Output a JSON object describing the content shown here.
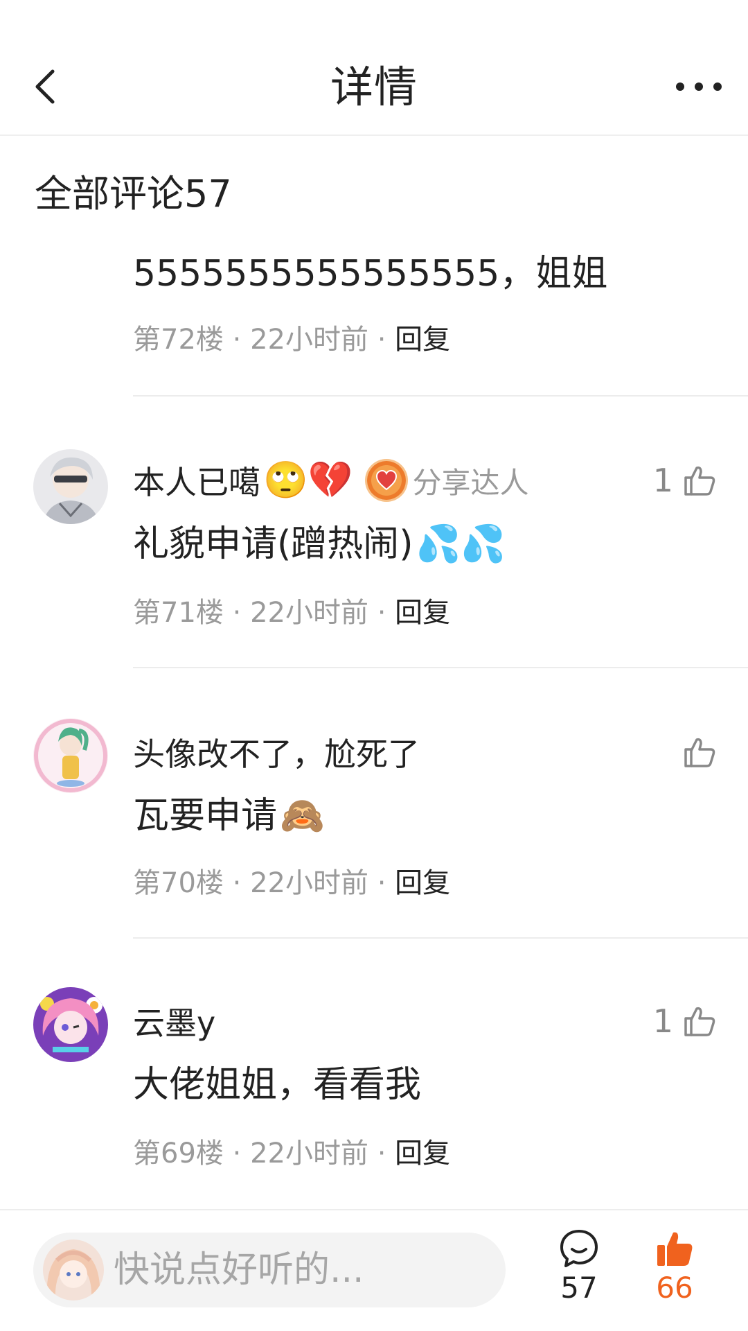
{
  "nav": {
    "title": "详情",
    "back_icon": "chevron-left-icon",
    "more_icon": "more-dots-icon"
  },
  "section": {
    "title": "全部评论57"
  },
  "comments": [
    {
      "username": "",
      "text": "5555555555555555，姐姐",
      "floor": "第72楼",
      "time": "22小时前",
      "reply": "回复",
      "likes": ""
    },
    {
      "username": "本人已噶",
      "username_emoji": "🙄💔",
      "badge_label": "分享达人",
      "text": "礼貌申请(蹭热闹)",
      "text_emoji": "💦💦",
      "floor": "第71楼",
      "time": "22小时前",
      "reply": "回复",
      "likes": "1"
    },
    {
      "username": "头像改不了，尬死了",
      "text": "瓦要申请",
      "text_emoji": "🙈",
      "floor": "第70楼",
      "time": "22小时前",
      "reply": "回复",
      "likes": ""
    },
    {
      "username": "云墨y",
      "text": "大佬姐姐，看看我",
      "floor": "第69楼",
      "time": "22小时前",
      "reply": "回复",
      "likes": "1"
    }
  ],
  "meta_separator": "·",
  "bottom_bar": {
    "placeholder": "快说点好听的...",
    "comment_count": "57",
    "like_count": "66"
  },
  "colors": {
    "accent_like": "#f0621e",
    "text_primary": "#222222",
    "text_secondary": "#9a9a9a"
  }
}
